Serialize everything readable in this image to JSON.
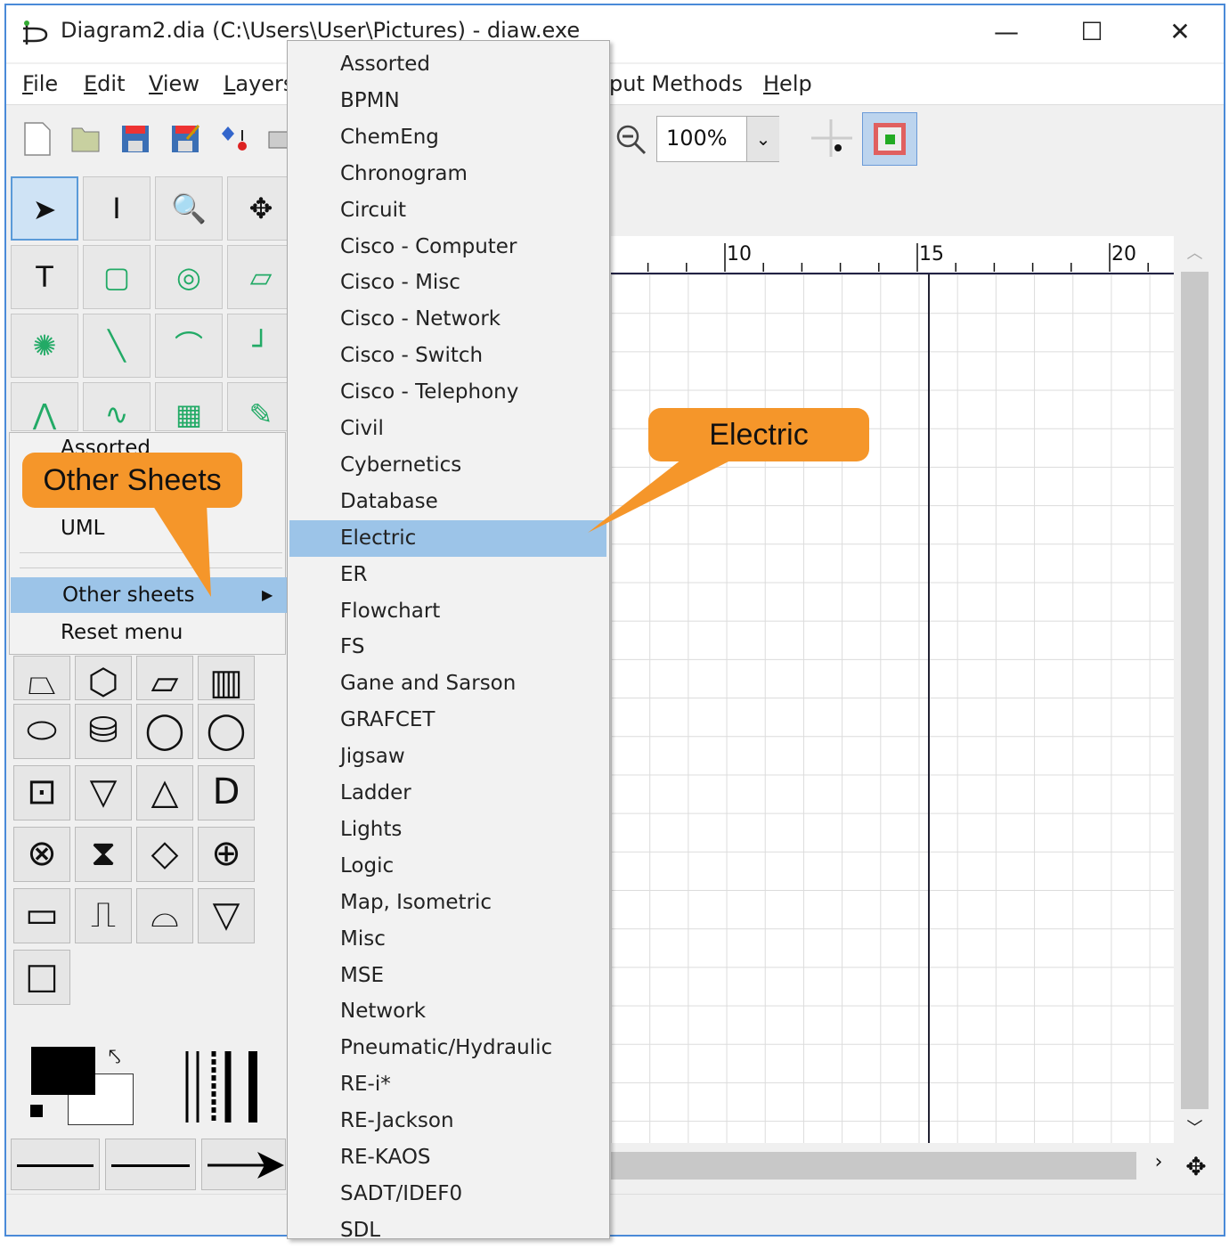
{
  "window": {
    "title": "Diagram2.dia (C:\\Users\\User\\Pictures) - diaw.exe",
    "minimize": "—",
    "maximize": "☐",
    "close": "✕"
  },
  "menubar": [
    {
      "u": "F",
      "rest": "ile"
    },
    {
      "u": "E",
      "rest": "dit"
    },
    {
      "u": "V",
      "rest": "iew"
    },
    {
      "u": "L",
      "rest": "ayers"
    }
  ],
  "menubar_right": [
    {
      "pre": "",
      "u": "",
      "rest": "put Methods"
    },
    {
      "u": "H",
      "rest": "elp"
    }
  ],
  "toolbar": {
    "zoom_value": "100%"
  },
  "ruler": {
    "labels": [
      "10",
      "15",
      "20"
    ]
  },
  "sheet_popup": {
    "partial_item": "Assorted",
    "items": [
      "UML",
      "Other sheets",
      "Reset menu"
    ],
    "highlighted": "Other sheets"
  },
  "submenu": {
    "items": [
      "Assorted",
      "BPMN",
      "ChemEng",
      "Chronogram",
      "Circuit",
      "Cisco - Computer",
      "Cisco - Misc",
      "Cisco - Network",
      "Cisco - Switch",
      "Cisco - Telephony",
      "Civil",
      "Cybernetics",
      "Database",
      "Electric",
      "ER",
      "Flowchart",
      "FS",
      "Gane and Sarson",
      "GRAFCET",
      "Jigsaw",
      "Ladder",
      "Lights",
      "Logic",
      "Map, Isometric",
      "Misc",
      "MSE",
      "Network",
      "Pneumatic/Hydraulic",
      "RE-i*",
      "RE-Jackson",
      "RE-KAOS",
      "SADT/IDEF0",
      "SDL"
    ],
    "highlighted": "Electric"
  },
  "callouts": {
    "other_sheets": "Other Sheets",
    "electric": "Electric"
  },
  "colors": {
    "highlight": "#9cc4e8",
    "callout": "#f5962a",
    "window_border": "#4a8ad8"
  }
}
